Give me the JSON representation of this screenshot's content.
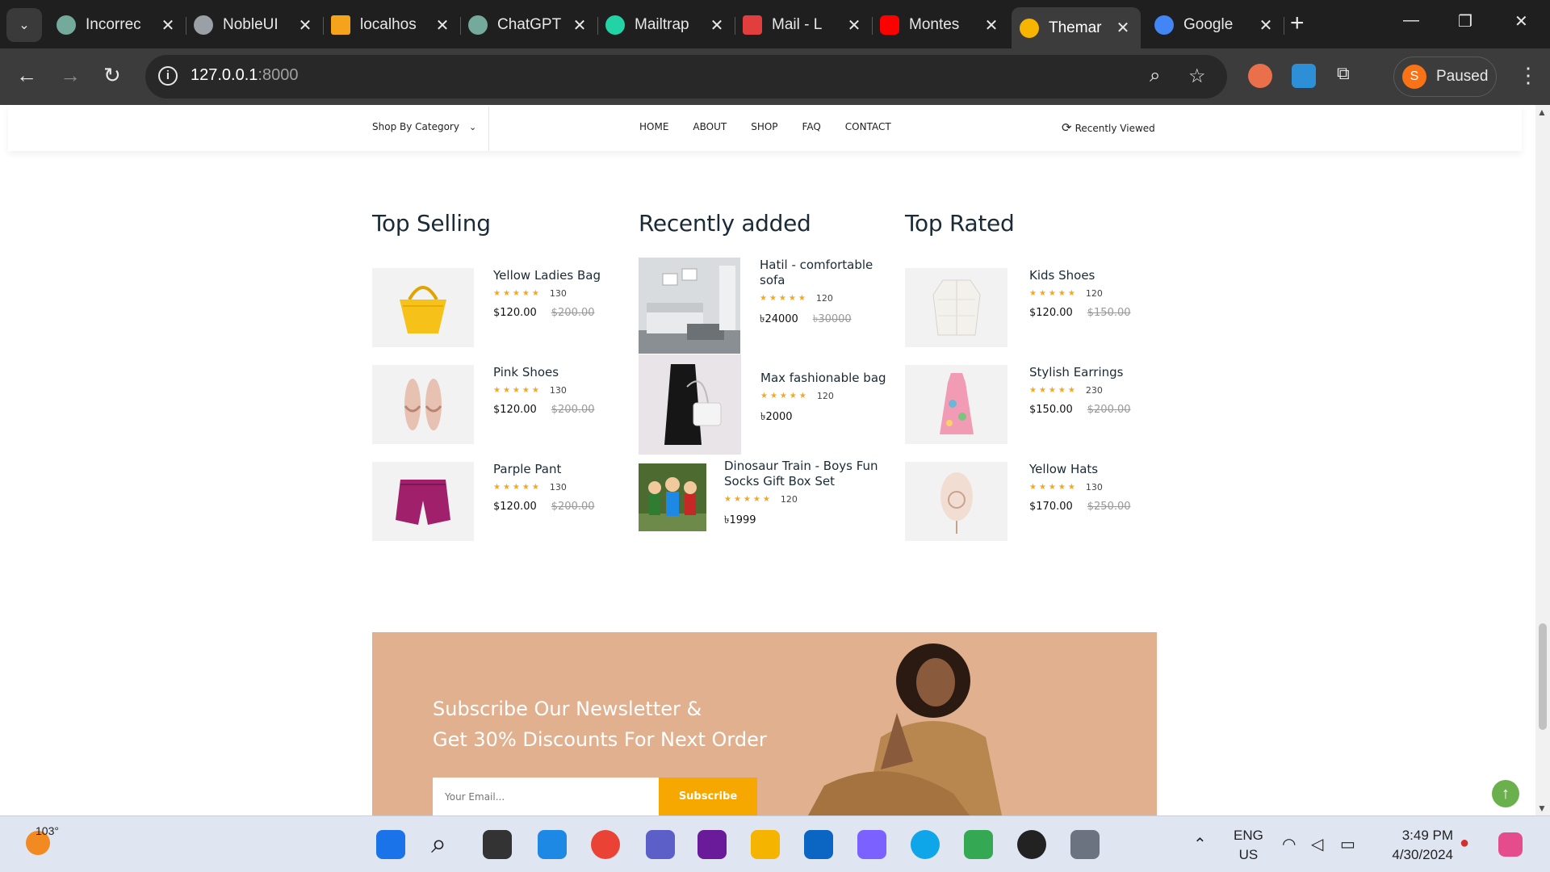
{
  "browser": {
    "tabs": [
      {
        "title": "Incorrec",
        "favicon_color": "#74aa9c"
      },
      {
        "title": "NobleUI",
        "favicon_color": "#9aa0a6"
      },
      {
        "title": "localhos",
        "favicon_color": "#f4a31a"
      },
      {
        "title": "ChatGPT",
        "favicon_color": "#74aa9c"
      },
      {
        "title": "Mailtrap",
        "favicon_color": "#22d3a6"
      },
      {
        "title": "Mail - L",
        "favicon_color": "#e23e3e"
      },
      {
        "title": "Montes",
        "favicon_color": "#ff0000"
      },
      {
        "title": "Themar",
        "favicon_color": "#f7b500"
      },
      {
        "title": "Google",
        "favicon_color": "#4285f4"
      }
    ],
    "active_tab_index": 7,
    "url_host": "127.0.0.1",
    "url_port": ":8000",
    "profile_initial": "S",
    "profile_status": "Paused"
  },
  "site_nav": {
    "category_label": "Shop By Category",
    "menu": [
      "HOME",
      "ABOUT",
      "SHOP",
      "FAQ",
      "CONTACT"
    ],
    "recently_viewed": "Recently Viewed"
  },
  "columns": [
    {
      "title": "Top Selling",
      "products": [
        {
          "name": "Yellow Ladies Bag",
          "reviews": "130",
          "price": "$120.00",
          "old_price": "$200.00",
          "image": "yellow-bag"
        },
        {
          "name": "Pink Shoes",
          "reviews": "130",
          "price": "$120.00",
          "old_price": "$200.00",
          "image": "sandals"
        },
        {
          "name": "Parple Pant",
          "reviews": "130",
          "price": "$120.00",
          "old_price": "$200.00",
          "image": "purple-shorts"
        }
      ]
    },
    {
      "title": "Recently added",
      "products": [
        {
          "name_line1": "Hatil - comfortable",
          "name_line2": "sofa",
          "reviews": "120",
          "price": "৳24000",
          "old_price": "৳30000",
          "image": "sofa-room"
        },
        {
          "name": "Max fashionable bag",
          "reviews": "120",
          "price": "৳2000",
          "image": "coat-bag"
        },
        {
          "name_line1": "Dinosaur Train - Boys Fun",
          "name_line2": "Socks Gift Box Set",
          "reviews": "120",
          "price": "৳1999",
          "image": "figurines"
        }
      ]
    },
    {
      "title": "Top Rated",
      "products": [
        {
          "name": "Kids Shoes",
          "reviews": "120",
          "price": "$120.00",
          "old_price": "$150.00",
          "image": "white-jacket"
        },
        {
          "name": "Stylish Earrings",
          "reviews": "230",
          "price": "$150.00",
          "old_price": "$200.00",
          "image": "pink-dress"
        },
        {
          "name": "Yellow Hats",
          "reviews": "130",
          "price": "$170.00",
          "old_price": "$250.00",
          "image": "hat"
        }
      ]
    }
  ],
  "stars": "★★★★★",
  "newsletter": {
    "line1": "Subscribe Our Newsletter &",
    "line2": "Get 30% Discounts For Next Order",
    "placeholder": "Your Email...",
    "button": "Subscribe"
  },
  "taskbar": {
    "temperature": "103°",
    "lang_line1": "ENG",
    "lang_line2": "US",
    "time": "3:49 PM",
    "date": "4/30/2024"
  },
  "colors": {
    "accent_orange": "#f7a800",
    "star": "#f5a623",
    "newsletter_bg": "#e0b08f"
  }
}
